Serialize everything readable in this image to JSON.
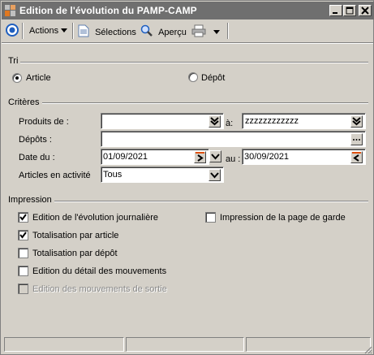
{
  "window": {
    "title": "Edition de l'évolution du PAMP-CAMP"
  },
  "toolbar": {
    "actions_label": "Actions",
    "selections_label": "Sélections",
    "preview_label": "Aperçu"
  },
  "sort": {
    "group_label": "Tri",
    "options": [
      {
        "label": "Article",
        "selected": true
      },
      {
        "label": "Dépôt",
        "selected": false
      }
    ]
  },
  "criteria": {
    "group_label": "Critères",
    "products_label": "Produits de :",
    "products_from": "",
    "to_label": "à:",
    "products_to": "zzzzzzzzzzzz",
    "depots_label": "Dépôts :",
    "depots_value": "",
    "date_label": "Date du :",
    "date_from": "01/09/2021",
    "date_to_label": "au :",
    "date_to": "30/09/2021",
    "active_label": "Articles en activité",
    "active_value": "Tous"
  },
  "printing": {
    "group_label": "Impression",
    "options": [
      {
        "label": "Edition de l'évolution journalière",
        "checked": true,
        "enabled": true
      },
      {
        "label": "Totalisation par article",
        "checked": true,
        "enabled": true
      },
      {
        "label": "Totalisation par dépôt",
        "checked": false,
        "enabled": true
      },
      {
        "label": "Edition du détail des mouvements",
        "checked": false,
        "enabled": true
      },
      {
        "label": "Edition des mouvements de sortie",
        "checked": false,
        "enabled": false
      },
      {
        "label": "Impression de la page de garde",
        "checked": false,
        "enabled": true
      }
    ]
  },
  "colors": {
    "titlebar": "#6f6f6f",
    "window": "#d4d0c8",
    "icon_blue": "#1f5fbf",
    "icon_orange": "#e07820"
  }
}
